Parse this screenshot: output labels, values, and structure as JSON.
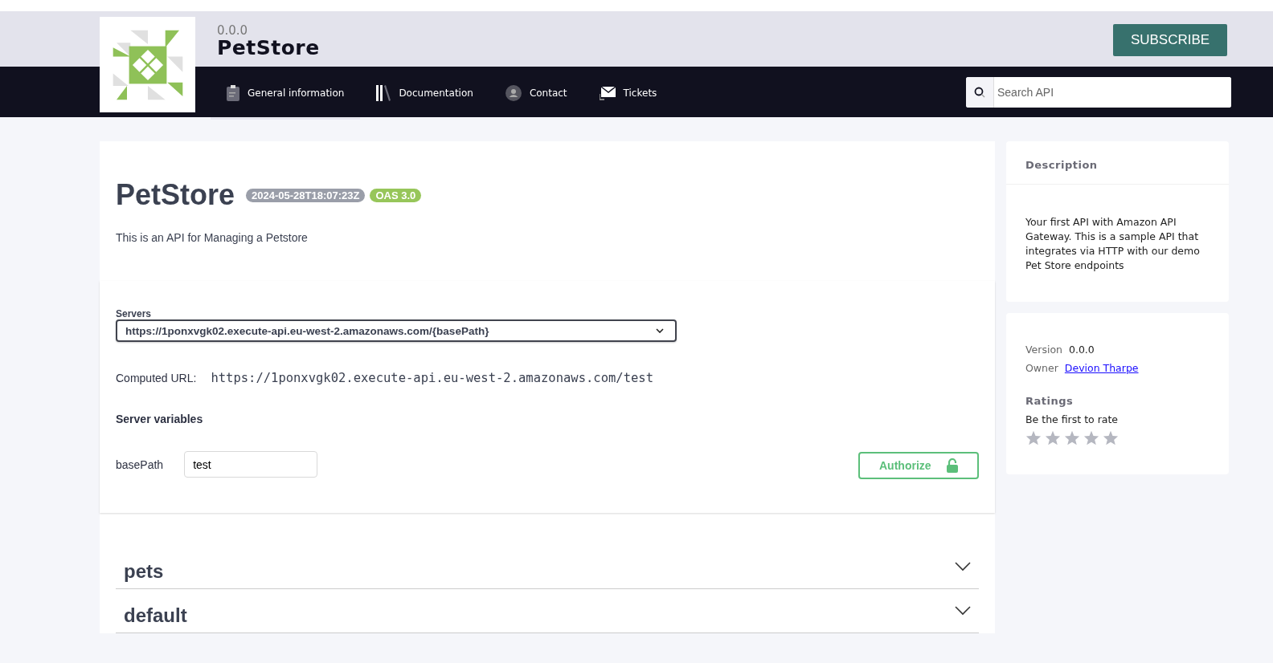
{
  "header": {
    "version": "0.0.0",
    "title": "PetStore",
    "subscribe": "SUBSCRIBE"
  },
  "tabs": [
    {
      "label": "General information",
      "kind": "clipboard",
      "selected": true
    },
    {
      "label": "Documentation",
      "kind": "books",
      "selected": false
    },
    {
      "label": "Contact",
      "kind": "person",
      "selected": false
    },
    {
      "label": "Tickets",
      "kind": "envelope",
      "selected": false
    }
  ],
  "search": {
    "placeholder": "Search API"
  },
  "api": {
    "title": "PetStore",
    "badges": [
      {
        "text": "2024-05-28T18:07:23Z",
        "color": "#9a9ea9"
      },
      {
        "text": "OAS 3.0",
        "color": "#97c65a"
      }
    ],
    "description": "This is an API for Managing a Petstore"
  },
  "servers": {
    "label": "Servers",
    "selected_server": "https://1ponxvgk02.execute-api.eu-west-2.amazonaws.com/{basePath}",
    "computed_label": "Computed URL:",
    "computed_url": "https://1ponxvgk02.execute-api.eu-west-2.amazonaws.com/test",
    "variables_title": "Server variables",
    "variables": [
      {
        "name": "basePath",
        "value": "test"
      }
    ],
    "authorize": "Authorize"
  },
  "sections": [
    {
      "name": "pets",
      "expanded": false
    },
    {
      "name": "default",
      "expanded": false
    }
  ],
  "sidebar": {
    "description_title": "Description",
    "description": "Your first API with Amazon API Gateway. This is a sample API that integrates via HTTP with our demo Pet Store endpoints",
    "version_label": "Version",
    "version": "0.0.0",
    "owner_label": "Owner",
    "owner": "Devion Tharpe",
    "ratings_title": "Ratings",
    "ratings_text": "Be the first to rate",
    "stars": 0
  }
}
